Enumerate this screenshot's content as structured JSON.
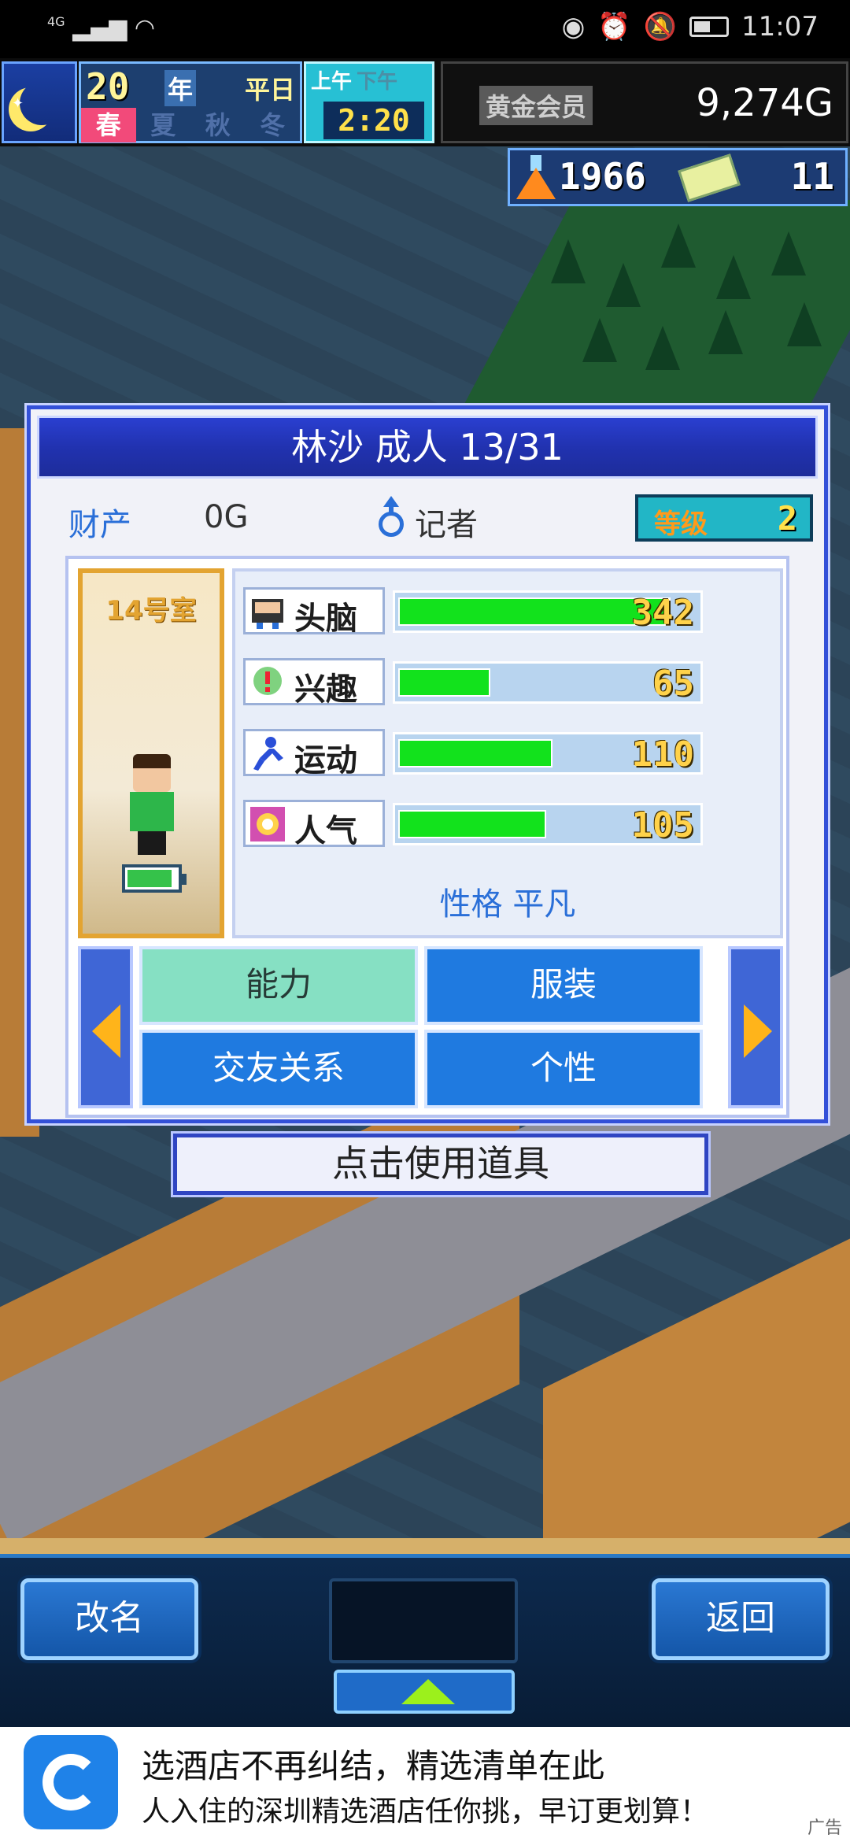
{
  "status_bar": {
    "network": "4G",
    "time": "11:07"
  },
  "hud": {
    "year": "20",
    "year_unit": "年",
    "weekday": "平日",
    "seasons": [
      "春",
      "夏",
      "秋",
      "冬"
    ],
    "active_season": "春",
    "am": "上午",
    "pm": "下午",
    "clock": "2:20",
    "membership": "黄金会员",
    "gold": "9,274G",
    "research_points": "1966",
    "tickets": "11"
  },
  "panel": {
    "title": "林沙 成人 13/31",
    "property_label": "财产",
    "property_value": "0G",
    "job": "记者",
    "level_label": "等级",
    "level_value": "2",
    "room": "14号室",
    "stats": [
      {
        "name": "头脑",
        "value": "342",
        "fill": 0.92,
        "icon": "brain-icon"
      },
      {
        "name": "兴趣",
        "value": "65",
        "fill": 0.31,
        "icon": "interest-icon"
      },
      {
        "name": "运动",
        "value": "110",
        "fill": 0.52,
        "icon": "sports-icon"
      },
      {
        "name": "人气",
        "value": "105",
        "fill": 0.5,
        "icon": "popularity-icon"
      }
    ],
    "personality": "性格 平凡",
    "tabs": {
      "ability": "能力",
      "clothing": "服装",
      "friends": "交友关系",
      "personality": "个性"
    }
  },
  "use_item_label": "点击使用道具",
  "bottom": {
    "rename": "改名",
    "back": "返回"
  },
  "ad": {
    "title": "选酒店不再纠结，精选清单在此",
    "subtitle": "人入住的深圳精选酒店任你挑，早订更划算！",
    "tag": "广告"
  },
  "colors": {
    "panel_border": "#3350d8",
    "tab_active": "#86e0c3",
    "tab": "#1f7ae0",
    "stat_fill": "#12e21c",
    "accent_orange": "#ffb41a"
  }
}
